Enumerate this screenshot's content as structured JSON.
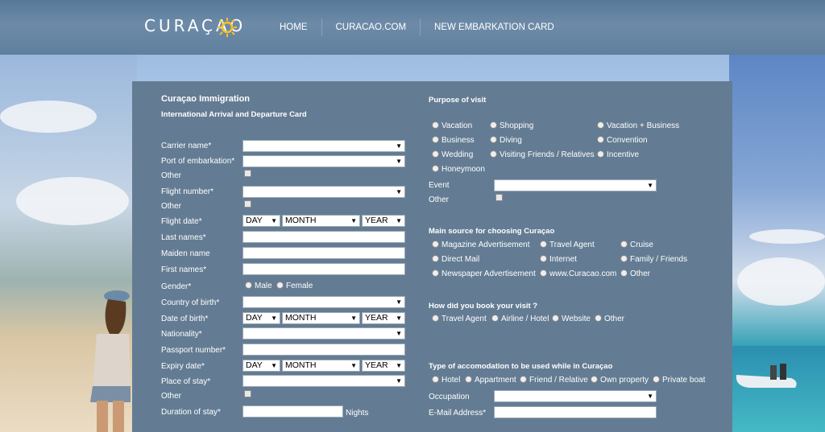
{
  "header": {
    "logo": "CURAÇAO",
    "nav": [
      "HOME",
      "CURACAO.COM",
      "NEW EMBARKATION CARD"
    ]
  },
  "form": {
    "title": "Curaçao Immigration",
    "subtitle": "International Arrival and Departure Card",
    "fields": {
      "carrier_name": "Carrier name*",
      "port_of_embarkation": "Port of embarkation*",
      "other1": "Other",
      "flight_number": "Flight number*",
      "other2": "Other",
      "flight_date": "Flight date*",
      "last_names": "Last names*",
      "maiden_name": "Maiden name",
      "first_names": "First names*",
      "gender": "Gender*",
      "country_of_birth": "Country of birth*",
      "date_of_birth": "Date of birth*",
      "nationality": "Nationality*",
      "passport_number": "Passport number*",
      "expiry_date": "Expiry date*",
      "place_of_stay": "Place of stay*",
      "other3": "Other",
      "duration_of_stay": "Duration of stay*",
      "nights": "Nights"
    },
    "date_selects": {
      "day": "DAY",
      "month": "MONTH",
      "year": "YEAR"
    },
    "gender_options": [
      "Male",
      "Female"
    ]
  },
  "purpose": {
    "heading": "Purpose of visit",
    "options": [
      "Vacation",
      "Shopping",
      "Vacation + Business",
      "Business",
      "Diving",
      "Convention",
      "Wedding",
      "Visiting Friends / Relatives",
      "Incentive",
      "Honeymoon"
    ],
    "event_label": "Event",
    "other_label": "Other"
  },
  "source": {
    "heading": "Main source for choosing Curaçao",
    "options": [
      "Magazine Advertisement",
      "Travel Agent",
      "Cruise",
      "Direct Mail",
      "Internet",
      "Family / Friends",
      "Newspaper Advertisement",
      "www.Curacao.com",
      "Other"
    ]
  },
  "booking": {
    "heading": "How did you book your visit ?",
    "options": [
      "Travel Agent",
      "Airline / Hotel",
      "Website",
      "Other"
    ]
  },
  "accommodation": {
    "heading": "Type of accomodation to be used while in Curaçao",
    "options": [
      "Hotel",
      "Appartment",
      "Friend / Relative",
      "Own property",
      "Private boat"
    ],
    "occupation_label": "Occupation",
    "email_label": "E-Mail Address*"
  }
}
